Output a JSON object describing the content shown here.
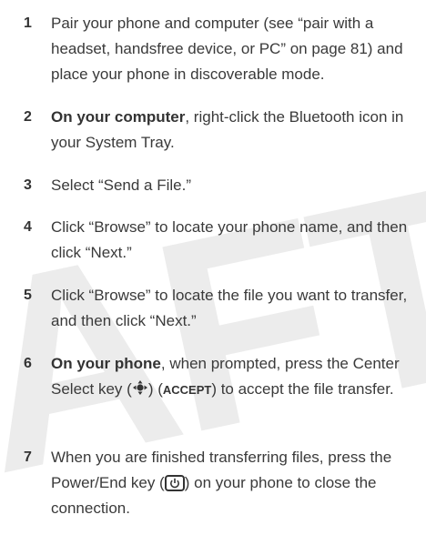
{
  "watermark": "AFT",
  "steps": [
    {
      "num": "1",
      "text": "Pair your phone and computer (see “pair with a headset, handsfree device, or PC” on page 81) and place your phone in discoverable mode."
    },
    {
      "num": "2",
      "bold": "On your computer",
      "text": ", right-click the Bluetooth icon in your System Tray."
    },
    {
      "num": "3",
      "text": "Select “Send a File.”"
    },
    {
      "num": "4",
      "text": "Click “Browse” to locate your phone name, and then click “Next.”"
    },
    {
      "num": "5",
      "text": "Click “Browse” to locate the file you want to transfer, and then click “Next.”"
    },
    {
      "num": "6",
      "bold": "On your phone",
      "text_a": ", when prompted, press the Center Select key (",
      "text_b": ") (",
      "key_label": "ACCEPT",
      "text_c": ") to accept the file transfer."
    },
    {
      "num": "7",
      "text_a": "When you are finished transferring files, press the Power/End key (",
      "text_b": ") on your phone to close the connection."
    }
  ],
  "icons": {
    "center_select": "nav-center-select-icon",
    "power_end": "power-end-key-icon"
  }
}
